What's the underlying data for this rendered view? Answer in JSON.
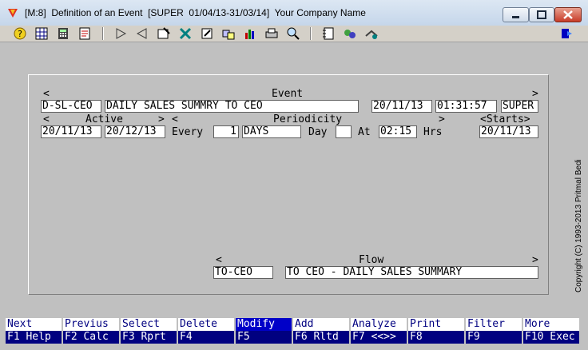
{
  "window": {
    "title": "[M:8]  Definition of an Event  [SUPER  01/04/13-31/03/14]  Your Company Name"
  },
  "toolbar": {
    "icons": [
      "help-icon",
      "grid-icon",
      "calculator-icon",
      "report-icon",
      "next-arrow-icon",
      "prev-arrow-icon",
      "select-icon",
      "tools-icon",
      "edit-icon",
      "transfer-icon",
      "chart-icon",
      "print-icon",
      "search-icon",
      "notes-icon",
      "analyze-icon",
      "settings-icon",
      "exit-icon"
    ]
  },
  "event": {
    "section_label": "Event",
    "code": "D-SL-CEO",
    "description": "DAILY SALES SUMMRY TO CEO",
    "date": "20/11/13",
    "time": "01:31:57",
    "user": "SUPER"
  },
  "active": {
    "section_label": "Active",
    "from": "20/11/13",
    "to": "20/12/13"
  },
  "periodicity": {
    "section_label": "Periodicity",
    "every_label": "Every",
    "every_value": "1",
    "unit": "DAYS",
    "day_label": "Day",
    "day_value": "",
    "at_label": "At",
    "at_value": "02:15",
    "hrs_label": "Hrs"
  },
  "starts": {
    "section_label": "<Starts>",
    "value": "20/11/13"
  },
  "flow": {
    "section_label": "Flow",
    "code": "TO-CEO",
    "description": "TO CEO - DAILY SALES SUMMARY"
  },
  "copyright": "Copyright  (C)  1993-2013  Pritmal Bedi",
  "fkeys": [
    {
      "top": "Next",
      "bottom": "F1 Help"
    },
    {
      "top": "Previus",
      "bottom": "F2 Calc"
    },
    {
      "top": "Select",
      "bottom": "F3 Rprt"
    },
    {
      "top": "Delete",
      "bottom": "F4"
    },
    {
      "top": "Modify",
      "bottom": "F5"
    },
    {
      "top": "Add",
      "bottom": "F6 Rltd"
    },
    {
      "top": "Analyze",
      "bottom": "F7 <<>>"
    },
    {
      "top": "Print",
      "bottom": "F8"
    },
    {
      "top": "Filter",
      "bottom": "F9"
    },
    {
      "top": "More",
      "bottom": "F10 Exec"
    }
  ]
}
